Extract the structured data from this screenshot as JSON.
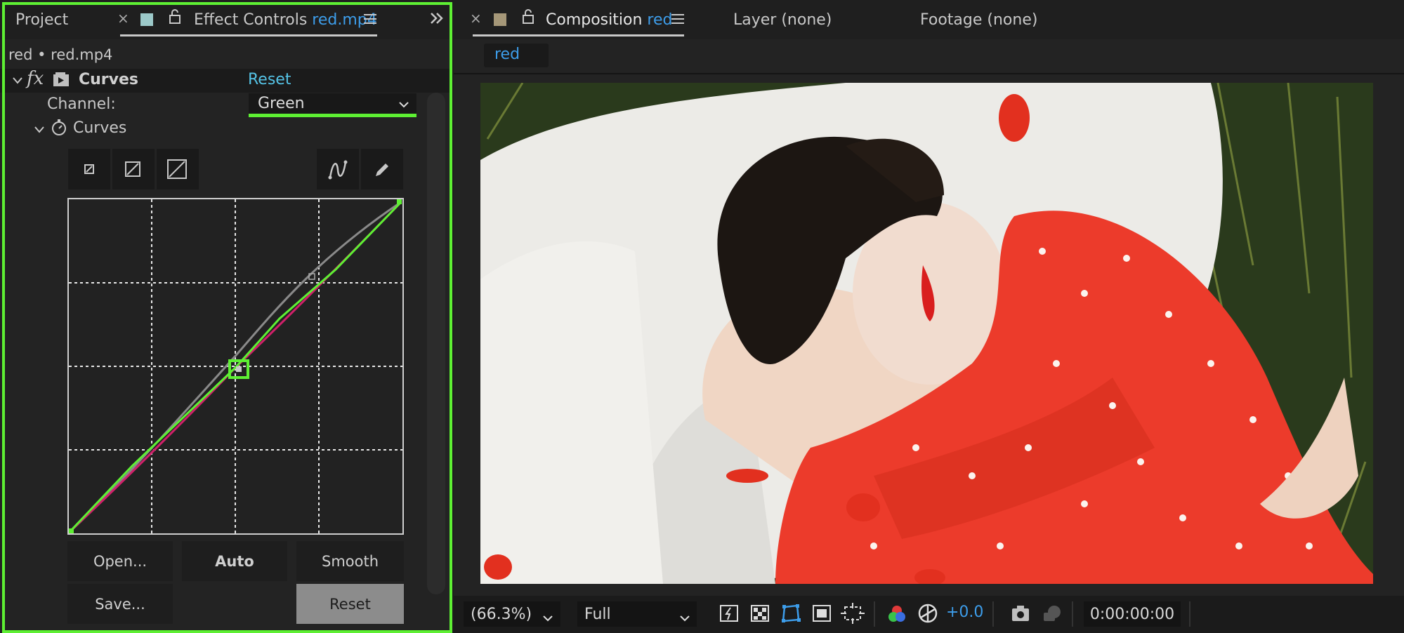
{
  "left_panel": {
    "tab_project": "Project",
    "tab_effect_controls_label": "Effect Controls",
    "tab_effect_controls_file": "red.mp4",
    "breadcrumb": "red • red.mp4",
    "effect_name": "Curves",
    "effect_reset": "Reset",
    "channel_label": "Channel:",
    "channel_value": "Green",
    "curves_group_label": "Curves",
    "buttons": {
      "open": "Open...",
      "auto": "Auto",
      "smooth": "Smooth",
      "save": "Save...",
      "reset": "Reset"
    }
  },
  "right_panel": {
    "tab_composition_label": "Composition",
    "tab_composition_name": "red",
    "tab_layer": "Layer (none)",
    "tab_footage": "Footage (none)",
    "comp_chip": "red",
    "bottom": {
      "zoom": "(66.3%)",
      "resolution": "Full",
      "exposure": "+0.0",
      "timecode": "0:00:00:00"
    }
  },
  "colors": {
    "selection_outline": "#5ef033",
    "accent_blue": "#3d9dea",
    "reset_link": "#55c3e6"
  }
}
